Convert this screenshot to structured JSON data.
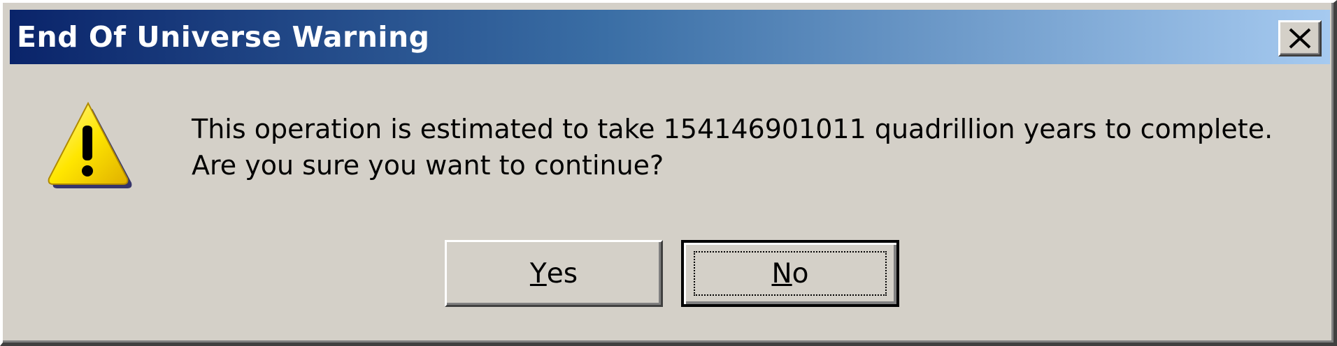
{
  "window": {
    "title": "End Of Universe Warning",
    "close_icon": "close-icon"
  },
  "dialog": {
    "icon": "warning-icon",
    "message_line1": "This operation is estimated to take 154146901011 quadrillion years to complete.",
    "message_line2": "Are you sure you want to continue?"
  },
  "buttons": {
    "yes": {
      "accel": "Y",
      "rest": "es",
      "focused": false
    },
    "no": {
      "accel": "N",
      "rest": "o",
      "focused": true
    }
  },
  "colors": {
    "titlebar_start": "#0a246a",
    "titlebar_end": "#a6caf0",
    "face": "#d4d0c8",
    "warning_yellow": "#ffe600"
  }
}
